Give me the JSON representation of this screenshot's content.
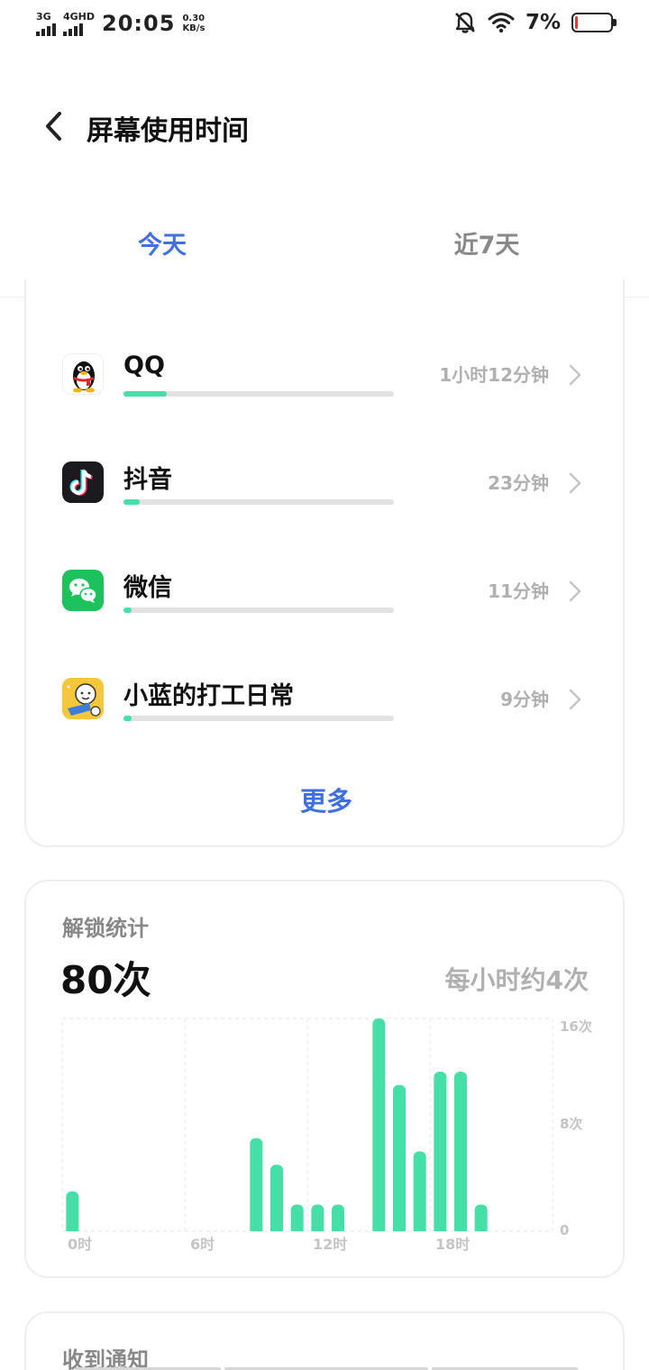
{
  "status_bar": {
    "signal1_label": "3G",
    "signal2_label": "4GHD",
    "time": "20:05",
    "net_speed_value": "0.30",
    "net_speed_unit": "KB/s",
    "battery_text": "7%",
    "battery_level": 0.07,
    "icons": [
      "mute-icon",
      "wifi-icon",
      "battery-icon"
    ]
  },
  "header": {
    "title": "屏幕使用时间",
    "back_icon": "chevron-left-icon"
  },
  "tabs": {
    "today": "今天",
    "last7": "近7天",
    "active": "today"
  },
  "apps": {
    "items": [
      {
        "name": "QQ",
        "time": "1小时12分钟",
        "usage_fraction": 0.16,
        "icon": "qq-penguin-icon"
      },
      {
        "name": "抖音",
        "time": "23分钟",
        "usage_fraction": 0.06,
        "icon": "douyin-icon"
      },
      {
        "name": "微信",
        "time": "11分钟",
        "usage_fraction": 0.03,
        "icon": "wechat-icon"
      },
      {
        "name": "小蓝的打工日常",
        "time": "9分钟",
        "usage_fraction": 0.03,
        "icon": "game-character-icon"
      }
    ],
    "more_label": "更多"
  },
  "unlock": {
    "title": "解锁统计",
    "count": "80次",
    "rate": "每小时约4次"
  },
  "notify": {
    "title": "收到通知"
  },
  "colors": {
    "accent": "#3f6fe0",
    "bar": "#46dfa8",
    "muted": "#b0b0b0"
  },
  "chart_data": {
    "type": "bar",
    "x_unit": "hour",
    "x": [
      0,
      9,
      10,
      11,
      12,
      13,
      15,
      16,
      17,
      18,
      19,
      20
    ],
    "values": [
      3,
      7,
      5,
      2,
      2,
      2,
      16,
      11,
      6,
      12,
      12,
      2
    ],
    "x_tick_labels": [
      {
        "hour": 0,
        "label": "0时"
      },
      {
        "hour": 6,
        "label": "6时"
      },
      {
        "hour": 12,
        "label": "12时"
      },
      {
        "hour": 18,
        "label": "18时"
      }
    ],
    "y_tick_labels": [
      {
        "value": 16,
        "label": "16次"
      },
      {
        "value": 8,
        "label": "8次"
      },
      {
        "value": 0,
        "label": "0"
      }
    ],
    "xlim": [
      0,
      24
    ],
    "ylim": [
      0,
      16
    ],
    "grid": true,
    "color": "#46dfa8"
  }
}
